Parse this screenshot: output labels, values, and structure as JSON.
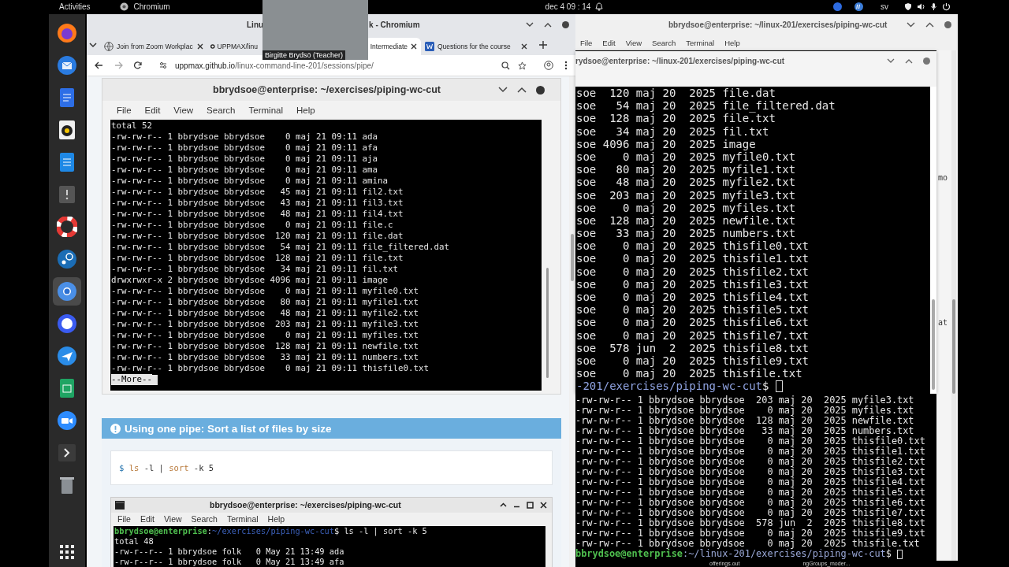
{
  "top_bar": {
    "activities": "Activities",
    "app": "Chromium",
    "clock": "dec 4 09 : 14",
    "keyboard_layout": "sv"
  },
  "dock": {
    "items": [
      {
        "kind": "firefox",
        "selected": false
      },
      {
        "kind": "mail",
        "selected": false
      },
      {
        "kind": "files",
        "selected": false
      },
      {
        "kind": "music",
        "selected": false
      },
      {
        "kind": "document",
        "selected": false
      },
      {
        "kind": "square",
        "selected": false
      },
      {
        "kind": "help",
        "selected": false
      },
      {
        "kind": "steam",
        "selected": false
      },
      {
        "kind": "chromium",
        "selected": true
      },
      {
        "kind": "chat",
        "selected": false
      },
      {
        "kind": "plane",
        "selected": false
      },
      {
        "kind": "sheet",
        "selected": false
      },
      {
        "kind": "zoom",
        "selected": false
      },
      {
        "kind": "terminal",
        "selected": false
      },
      {
        "kind": "trash",
        "selected": false
      }
    ]
  },
  "webcam": {
    "caption": "Birgitte Brydsö (Teacher)"
  },
  "browser": {
    "title_parts": [
      "Linu",
      "k - Chromium"
    ],
    "tabs": [
      {
        "label": "Join from Zoom Workplac",
        "kind": "globe",
        "selected": false
      },
      {
        "label": "UPPMAX/linu",
        "kind": "github",
        "selected": false
      },
      {
        "label": "Intermediate",
        "kind": "plain",
        "selected": true
      },
      {
        "label": "Questions for the course",
        "kind": "word",
        "selected": false
      }
    ],
    "url_host": "uppmax.github.io",
    "url_path": "/linux-command-line-201/sessions/pipe/"
  },
  "page": {
    "terminal_1": {
      "title": "bbrydsoe@enterprise: ~/exercises/piping-wc-cut",
      "menu": [
        "File",
        "Edit",
        "View",
        "Search",
        "Terminal",
        "Help"
      ],
      "lines": [
        "total 52",
        "-rw-rw-r-- 1 bbrydsoe bbrydsoe    0 maj 21 09:11 ada",
        "-rw-rw-r-- 1 bbrydsoe bbrydsoe    0 maj 21 09:11 afa",
        "-rw-rw-r-- 1 bbrydsoe bbrydsoe    0 maj 21 09:11 aja",
        "-rw-rw-r-- 1 bbrydsoe bbrydsoe    0 maj 21 09:11 ama",
        "-rw-rw-r-- 1 bbrydsoe bbrydsoe    0 maj 21 09:11 amina",
        "-rw-rw-r-- 1 bbrydsoe bbrydsoe   45 maj 21 09:11 fil2.txt",
        "-rw-rw-r-- 1 bbrydsoe bbrydsoe   43 maj 21 09:11 fil3.txt",
        "-rw-rw-r-- 1 bbrydsoe bbrydsoe   48 maj 21 09:11 fil4.txt",
        "-rw-rw-r-- 1 bbrydsoe bbrydsoe    0 maj 21 09:11 file.c",
        "-rw-rw-r-- 1 bbrydsoe bbrydsoe  120 maj 21 09:11 file.dat",
        "-rw-rw-r-- 1 bbrydsoe bbrydsoe   54 maj 21 09:11 file_filtered.dat",
        "-rw-rw-r-- 1 bbrydsoe bbrydsoe  128 maj 21 09:11 file.txt",
        "-rw-rw-r-- 1 bbrydsoe bbrydsoe   34 maj 21 09:11 fil.txt",
        "drwxrwxr-x 2 bbrydsoe bbrydsoe 4096 maj 21 09:11 image",
        "-rw-rw-r-- 1 bbrydsoe bbrydsoe    0 maj 21 09:11 myfile0.txt",
        "-rw-rw-r-- 1 bbrydsoe bbrydsoe   80 maj 21 09:11 myfile1.txt",
        "-rw-rw-r-- 1 bbrydsoe bbrydsoe   48 maj 21 09:11 myfile2.txt",
        "-rw-rw-r-- 1 bbrydsoe bbrydsoe  203 maj 21 09:11 myfile3.txt",
        "-rw-rw-r-- 1 bbrydsoe bbrydsoe    0 maj 21 09:11 myfiles.txt",
        "-rw-rw-r-- 1 bbrydsoe bbrydsoe  128 maj 21 09:11 newfile.txt",
        "-rw-rw-r-- 1 bbrydsoe bbrydsoe   33 maj 21 09:11 numbers.txt",
        "-rw-rw-r-- 1 bbrydsoe bbrydsoe    0 maj 21 09:11 thisfile0.txt"
      ],
      "pager": "--More--"
    },
    "admonition": {
      "title": "Using one pipe: Sort a list of files by size"
    },
    "code": [
      {
        "text": "$ ",
        "kind": "prompt"
      },
      {
        "text": "ls",
        "kind": "command"
      },
      {
        "text": " -l | ",
        "kind": "plain"
      },
      {
        "text": "sort",
        "kind": "command"
      },
      {
        "text": " -k 5",
        "kind": "plain"
      }
    ],
    "terminal_2": {
      "title": "bbrydsoe@enterprise: ~/exercises/piping-wc-cut",
      "menu": [
        "File",
        "Edit",
        "View",
        "Search",
        "Terminal",
        "Help"
      ],
      "prompt": [
        {
          "text": "bbrydsoe@enterprise",
          "kind": "user"
        },
        {
          "text": ":",
          "kind": "plain"
        },
        {
          "text": "~/exercises/piping-wc-cut",
          "kind": "path"
        },
        {
          "text": "$ ls -l | sort -k 5",
          "kind": "plain"
        }
      ],
      "lines": [
        "total 48",
        "-rw-r--r-- 1 bbrydsoe folk   0 May 21 13:49 ada",
        "-rw-r--r-- 1 bbrydsoe folk   0 May 21 13:49 afa"
      ]
    }
  },
  "right_terminal": {
    "title": "bbrydsoe@enterprise: ~/linux-201/exercises/piping-wc-cut",
    "menu": [
      "File",
      "Edit",
      "View",
      "Search",
      "Terminal",
      "Help"
    ],
    "lines": [
      "-rw-rw-r-- 1 bbrydsoe bbrydsoe  203 maj 20  2025 myfile3.txt",
      "-rw-rw-r-- 1 bbrydsoe bbrydsoe    0 maj 20  2025 myfiles.txt",
      "-rw-rw-r-- 1 bbrydsoe bbrydsoe  128 maj 20  2025 newfile.txt",
      "-rw-rw-r-- 1 bbrydsoe bbrydsoe   33 maj 20  2025 numbers.txt",
      "-rw-rw-r-- 1 bbrydsoe bbrydsoe    0 maj 20  2025 thisfile0.txt",
      "-rw-rw-r-- 1 bbrydsoe bbrydsoe    0 maj 20  2025 thisfile1.txt",
      "-rw-rw-r-- 1 bbrydsoe bbrydsoe    0 maj 20  2025 thisfile2.txt",
      "-rw-rw-r-- 1 bbrydsoe bbrydsoe    0 maj 20  2025 thisfile3.txt",
      "-rw-rw-r-- 1 bbrydsoe bbrydsoe    0 maj 20  2025 thisfile4.txt",
      "-rw-rw-r-- 1 bbrydsoe bbrydsoe    0 maj 20  2025 thisfile5.txt",
      "-rw-rw-r-- 1 bbrydsoe bbrydsoe    0 maj 20  2025 thisfile6.txt",
      "-rw-rw-r-- 1 bbrydsoe bbrydsoe    0 maj 20  2025 thisfile7.txt",
      "-rw-rw-r-- 1 bbrydsoe bbrydsoe  578 jun  2  2025 thisfile8.txt",
      "-rw-rw-r-- 1 bbrydsoe bbrydsoe    0 maj 20  2025 thisfile9.txt",
      "-rw-rw-r-- 1 bbrydsoe bbrydsoe    0 maj 20  2025 thisfile.txt"
    ],
    "prompt": [
      {
        "text": "bbrydsoe@enterprise",
        "kind": "user"
      },
      {
        "text": ":~/linux-201/exercises/piping-wc-cut",
        "kind": "path"
      },
      {
        "text": "$ ",
        "kind": "plain"
      }
    ],
    "cursor": true
  },
  "inner_terminal": {
    "title": "rydsoe@enterprise: ~/linux-201/exercises/piping-wc-cut",
    "lines": [
      "soe  120 maj 20  2025 file.dat",
      "soe   54 maj 20  2025 file_filtered.dat",
      "soe  128 maj 20  2025 file.txt",
      "soe   34 maj 20  2025 fil.txt",
      "soe 4096 maj 20  2025 image",
      "soe    0 maj 20  2025 myfile0.txt",
      "soe   80 maj 20  2025 myfile1.txt",
      "soe   48 maj 20  2025 myfile2.txt",
      "soe  203 maj 20  2025 myfile3.txt",
      "soe    0 maj 20  2025 myfiles.txt",
      "soe  128 maj 20  2025 newfile.txt",
      "soe   33 maj 20  2025 numbers.txt",
      "soe    0 maj 20  2025 thisfile0.txt",
      "soe    0 maj 20  2025 thisfile1.txt",
      "soe    0 maj 20  2025 thisfile2.txt",
      "soe    0 maj 20  2025 thisfile3.txt",
      "soe    0 maj 20  2025 thisfile4.txt",
      "soe    0 maj 20  2025 thisfile5.txt",
      "soe    0 maj 20  2025 thisfile6.txt",
      "soe    0 maj 20  2025 thisfile7.txt",
      "soe  578 jun  2  2025 thisfile8.txt",
      "soe    0 maj 20  2025 thisfile9.txt",
      "soe    0 maj 20  2025 thisfile.txt"
    ],
    "prompt": [
      {
        "text": "-201/exercises/piping-wc-cut",
        "kind": "path"
      },
      {
        "text": "$ ",
        "kind": "plain"
      }
    ],
    "cursor": true
  },
  "background_fragments": [
    "mo",
    "at"
  ],
  "desktop_labels": [
    "offerings.out",
    "ngGroups_moder..."
  ]
}
